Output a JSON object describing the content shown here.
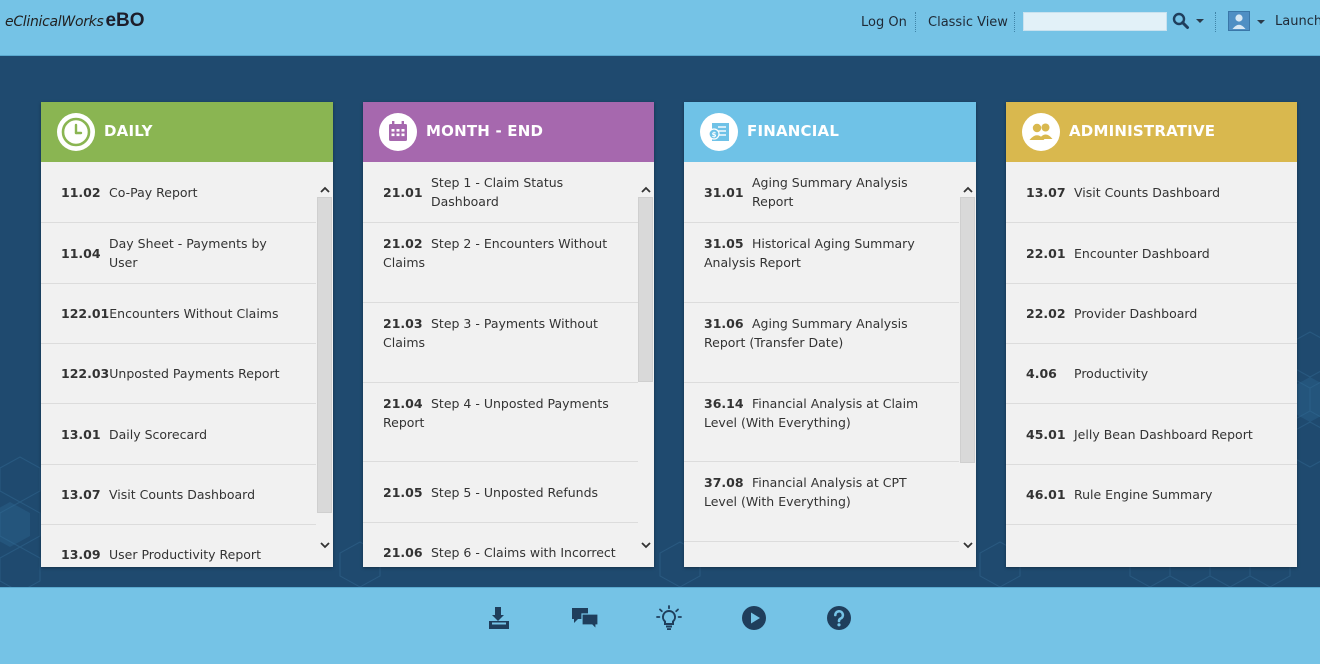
{
  "header": {
    "brand": "eClinicalWorks",
    "product": "eBO",
    "log_on": "Log On",
    "classic_view": "Classic View",
    "search_value": "",
    "launch": "Launch"
  },
  "cards": [
    {
      "title": "DAILY",
      "color": "#8ab552",
      "items": [
        {
          "code": "11.02",
          "label": "Co-Pay Report"
        },
        {
          "code": "11.04",
          "label": "Day Sheet - Payments by User"
        },
        {
          "code": "122.01",
          "label": "Encounters Without Claims"
        },
        {
          "code": "122.03",
          "label": "Unposted Payments Report"
        },
        {
          "code": "13.01",
          "label": "Daily Scorecard"
        },
        {
          "code": "13.07",
          "label": "Visit Counts Dashboard"
        },
        {
          "code": "13.09",
          "label": "User Productivity Report"
        }
      ]
    },
    {
      "title": "MONTH - END",
      "color": "#a668ae",
      "items": [
        {
          "code": "21.01",
          "label": "Step 1 - Claim Status Dashboard"
        },
        {
          "code": "21.02",
          "label": "Step 2 - Encounters Without Claims"
        },
        {
          "code": "21.03",
          "label": "Step 3 - Payments Without Claims"
        },
        {
          "code": "21.04",
          "label": "Step 4 - Unposted Payments Report"
        },
        {
          "code": "21.05",
          "label": "Step 5 - Unposted Refunds"
        },
        {
          "code": "21.06",
          "label": "Step 6 - Claims with Incorrect"
        }
      ]
    },
    {
      "title": "FINANCIAL",
      "color": "#6fc2e7",
      "items": [
        {
          "code": "31.01",
          "label": "Aging Summary Analysis Report"
        },
        {
          "code": "31.05",
          "label": "Historical Aging Summary Analysis Report"
        },
        {
          "code": "31.06",
          "label": "Aging Summary Analysis Report (Transfer Date)"
        },
        {
          "code": "36.14",
          "label": "Financial Analysis at Claim Level (With Everything)"
        },
        {
          "code": "37.08",
          "label": "Financial Analysis at CPT Level (With Everything)"
        }
      ]
    },
    {
      "title": "ADMINISTRATIVE",
      "color": "#d9b84e",
      "items": [
        {
          "code": "13.07",
          "label": "Visit Counts Dashboard"
        },
        {
          "code": "22.01",
          "label": "Encounter Dashboard"
        },
        {
          "code": "22.02",
          "label": "Provider Dashboard"
        },
        {
          "code": "4.06",
          "label": "Productivity"
        },
        {
          "code": "45.01",
          "label": "Jelly Bean Dashboard Report"
        },
        {
          "code": "46.01",
          "label": "Rule Engine Summary"
        }
      ]
    }
  ],
  "colors": {
    "header_bg": "#75c3e6",
    "main_bg": "#1f4a6f",
    "icon_dark": "#1f3e5c"
  },
  "footer_icons": [
    "export-icon",
    "chat-icon",
    "lightbulb-icon",
    "play-icon",
    "help-icon"
  ]
}
